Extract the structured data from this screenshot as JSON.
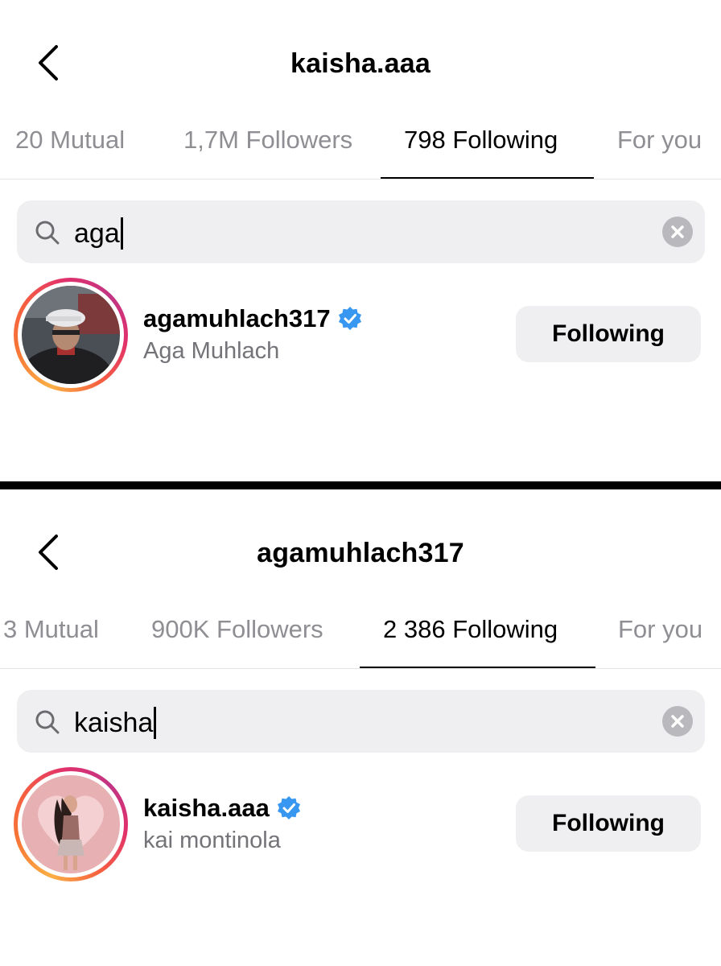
{
  "panels": [
    {
      "title": "kaisha.aaa",
      "tabs": [
        "20 Mutual",
        "1,7M Followers",
        "798 Following",
        "For you"
      ],
      "active_tab": "798 Following",
      "search": {
        "value": "aga"
      },
      "result": {
        "username": "agamuhlach317",
        "full_name": "Aga Muhlach",
        "verified": true,
        "button_label": "Following"
      }
    },
    {
      "title": "agamuhlach317",
      "tabs": [
        "3 Mutual",
        "900K Followers",
        "2 386 Following",
        "For you"
      ],
      "active_tab": "2 386 Following",
      "search": {
        "value": "kaisha"
      },
      "result": {
        "username": "kaisha.aaa",
        "full_name": "kai montinola",
        "verified": true,
        "button_label": "Following"
      }
    }
  ],
  "icons": {
    "back": "chevron-left-icon",
    "search": "search-icon",
    "clear": "clear-icon",
    "verified": "verified-badge-icon"
  },
  "colors": {
    "verified_blue": "#3897f0",
    "tab_inactive": "#8e8e93",
    "button_bg": "#efeff1",
    "divider": "#000000"
  }
}
